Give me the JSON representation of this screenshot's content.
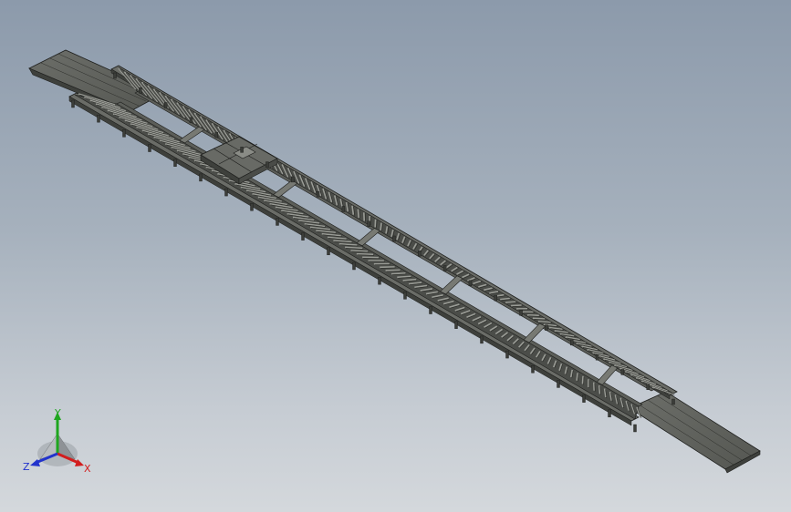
{
  "view": {
    "background_top": "#8c9aab",
    "background_bottom": "#d4d8dc",
    "model": "roller-conveyor-assembly",
    "render_style": "shaded-with-edges",
    "colors": {
      "steel_face": "#5f625c",
      "steel_dark": "#3e403c",
      "steel_light": "#8a8c86",
      "edge": "#1e1f1d"
    }
  },
  "triad": {
    "x_label": "X",
    "y_label": "Y",
    "z_label": "Z",
    "x_color": "#d21e1e",
    "y_color": "#1fa61f",
    "z_color": "#2233cc"
  }
}
